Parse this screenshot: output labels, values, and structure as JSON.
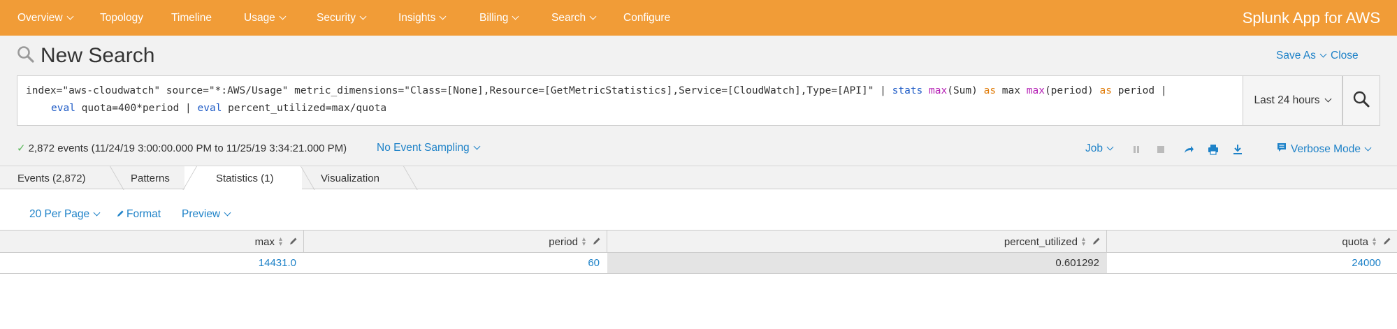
{
  "nav": {
    "items": [
      {
        "label": "Overview",
        "dropdown": true
      },
      {
        "label": "Topology",
        "dropdown": false
      },
      {
        "label": "Timeline",
        "dropdown": false
      },
      {
        "label": "Usage",
        "dropdown": true
      },
      {
        "label": "Security",
        "dropdown": true
      },
      {
        "label": "Insights",
        "dropdown": true
      },
      {
        "label": "Billing",
        "dropdown": true
      },
      {
        "label": "Search",
        "dropdown": true
      },
      {
        "label": "Configure",
        "dropdown": false
      }
    ],
    "app_title": "Splunk App for AWS"
  },
  "header": {
    "title": "New Search",
    "save_as": "Save As",
    "close": "Close"
  },
  "search": {
    "line1": {
      "p1": "index=\"aws-cloudwatch\" source=\"*:AWS/Usage\" metric_dimensions=\"Class=[None],Resource=[GetMetricStatistics],Service=[CloudWatch],Type=[API]\" | ",
      "stats": "stats",
      "max1": "max",
      "p2": "(Sum) ",
      "as1": "as",
      "p3": " max ",
      "max2": "max",
      "p4": "(period) ",
      "as2": "as",
      "p5": " period |"
    },
    "line2": {
      "eval1": "eval",
      "p1": " quota=400*period | ",
      "eval2": "eval",
      "p2": " percent_utilized=max/quota"
    },
    "time_range": "Last 24 hours"
  },
  "status": {
    "events": "2,872 events (11/24/19 3:00:00.000 PM to 11/25/19 3:34:21.000 PM)",
    "sampling": "No Event Sampling",
    "job": "Job",
    "mode": "Verbose Mode"
  },
  "tabs": [
    {
      "label": "Events (2,872)",
      "active": false
    },
    {
      "label": "Patterns",
      "active": false
    },
    {
      "label": "Statistics (1)",
      "active": true
    },
    {
      "label": "Visualization",
      "active": false
    }
  ],
  "options": {
    "per_page": "20 Per Page",
    "format": "Format",
    "preview": "Preview"
  },
  "table": {
    "columns": [
      "max",
      "period",
      "percent_utilized",
      "quota"
    ],
    "rows": [
      [
        "14431.0",
        "60",
        "0.601292",
        "24000"
      ]
    ]
  },
  "colors": {
    "nav_bg": "#f19c37",
    "link": "#1e82c8",
    "header_bg": "#f2f2f2"
  }
}
